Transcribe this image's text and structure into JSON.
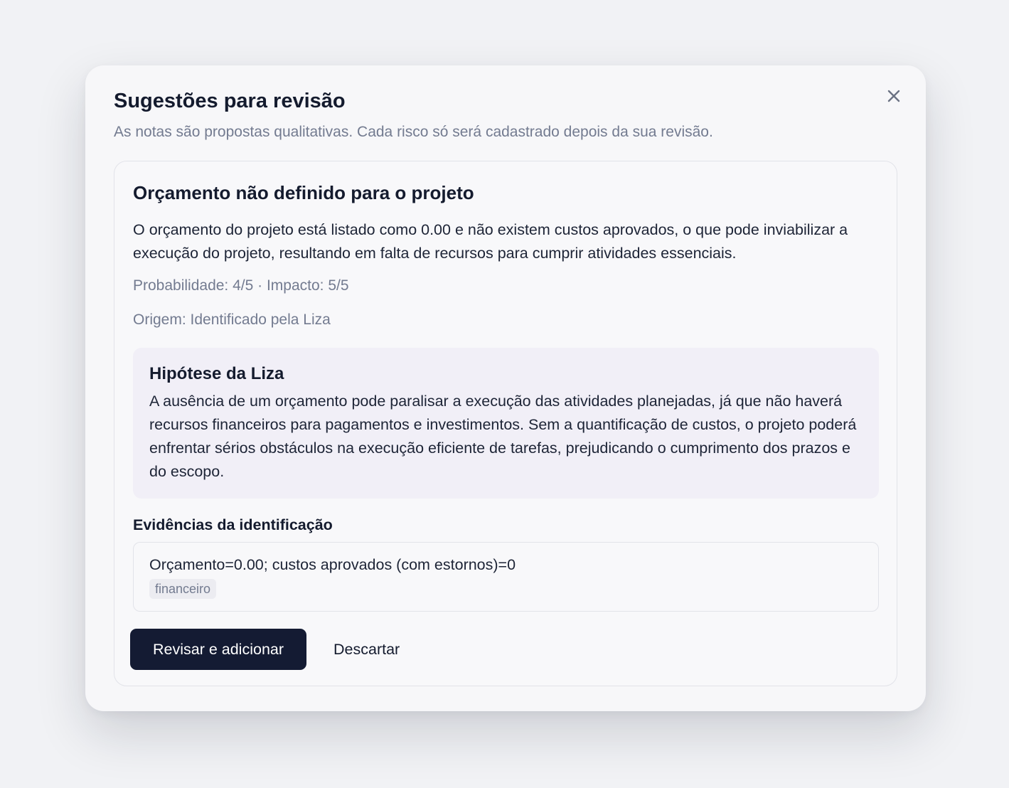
{
  "modal": {
    "title": "Sugestões para revisão",
    "subtitle": "As notas são propostas qualitativas. Cada risco só será cadastrado depois da sua revisão.",
    "close_icon": "close-icon"
  },
  "suggestion": {
    "title": "Orçamento não definido para o projeto",
    "description": "O orçamento do projeto está listado como 0.00 e não existem custos aprovados, o que pode inviabilizar a execução do projeto, resultando em falta de recursos para cumprir atividades essenciais.",
    "scores": "Probabilidade: 4/5 · Impacto: 5/5",
    "origin": "Origem: Identificado pela Liza",
    "hypothesis": {
      "title": "Hipótese da Liza",
      "text": "A ausência de um orçamento pode paralisar a execução das atividades planejadas, já que não haverá recursos financeiros para pagamentos e investimentos. Sem a quantificação de custos, o projeto poderá enfrentar sérios obstáculos na execução eficiente de tarefas, prejudicando o cumprimento dos prazos e do escopo."
    },
    "evidence": {
      "heading": "Evidências da identificação",
      "text": "Orçamento=0.00; custos aprovados (com estornos)=0",
      "tag": "financeiro"
    },
    "actions": {
      "primary_label": "Revisar e adicionar",
      "secondary_label": "Descartar"
    }
  },
  "colors": {
    "page_background": "#f1f2f5",
    "text_primary": "#141b2e",
    "text_muted": "#737b90",
    "hypothesis_background": "#f1eff7",
    "primary_button": "#141b33"
  }
}
